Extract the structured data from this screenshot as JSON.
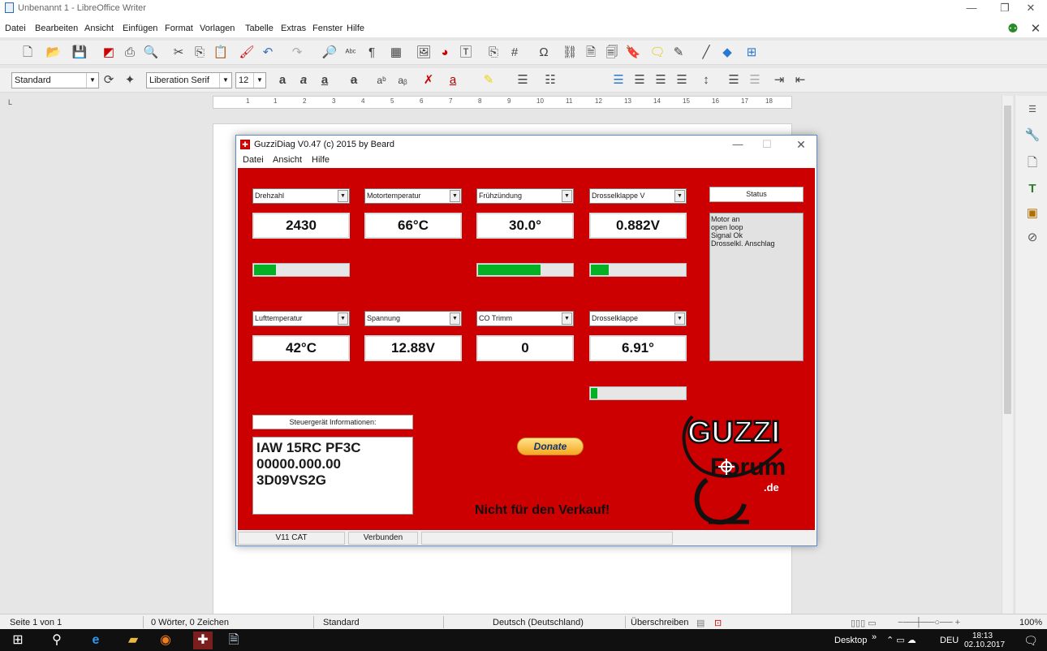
{
  "app": {
    "title": "Unbenannt 1 - LibreOffice Writer",
    "menu": [
      "Datei",
      "Bearbeiten",
      "Ansicht",
      "Einfügen",
      "Format",
      "Vorlagen",
      "Tabelle",
      "Extras",
      "Fenster",
      "Hilfe"
    ],
    "paragraph_style": "Standard",
    "font_name": "Liberation Serif",
    "font_size": "12",
    "ruler_marks": [
      "1",
      "1",
      "2",
      "3",
      "4",
      "5",
      "6",
      "7",
      "8",
      "9",
      "10",
      "11",
      "12",
      "13",
      "14",
      "15",
      "16",
      "17",
      "18"
    ],
    "ruler_unit_mark": "L"
  },
  "statusbar": {
    "page": "Seite 1 von 1",
    "words": "0 Wörter, 0 Zeichen",
    "style": "Standard",
    "language": "Deutsch (Deutschland)",
    "mode": "Überschreiben",
    "zoom": "100%"
  },
  "taskbar": {
    "desktop": "Desktop",
    "lang": "DEU",
    "time": "18:13",
    "date": "02.10.2017"
  },
  "guzzi": {
    "title": "GuzziDiag V0.47  (c) 2015 by Beard",
    "menu": [
      "Datei",
      "Ansicht",
      "Hilfe"
    ],
    "gauges": [
      {
        "select": "Drehzahl",
        "value": "2430",
        "bar": 0.23
      },
      {
        "select": "Motortemperatur",
        "value": "66°C",
        "bar": null
      },
      {
        "select": "Frühzündung",
        "value": "30.0°",
        "bar": 0.66
      },
      {
        "select": "Drosselklappe V",
        "value": "0.882V",
        "bar": 0.19
      },
      {
        "select": "Lufttemperatur",
        "value": "42°C",
        "bar": null
      },
      {
        "select": "Spannung",
        "value": "12.88V",
        "bar": null
      },
      {
        "select": "CO Trimm",
        "value": "0",
        "bar": null
      },
      {
        "select": "Drosselklappe",
        "value": "6.91°",
        "bar": 0.07
      }
    ],
    "status_label": "Status",
    "status_lines": [
      "Motor an",
      "open loop",
      "Signal Ok",
      "Drosselkl. Anschlag"
    ],
    "info_label": "Steuergerät Informationen:",
    "info_lines": [
      "IAW 15RC PF3C",
      "00000.000.00",
      "3D09VS2G"
    ],
    "donate": "Donate",
    "notice": "Nicht für den Verkauf!",
    "logo_text": [
      "GUZZI",
      "Forum",
      ".de"
    ],
    "statusbar": [
      "V11 CAT",
      "Verbunden"
    ]
  },
  "colors": {
    "body_red": "#cc0000",
    "bar_green": "#06b025"
  }
}
